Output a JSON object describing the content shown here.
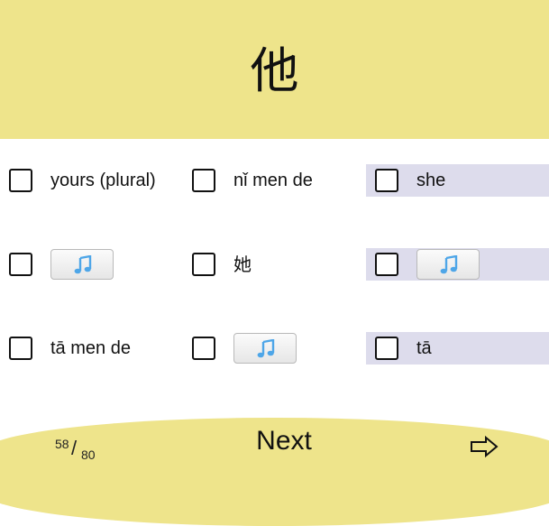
{
  "prompt": {
    "character": "他"
  },
  "options": [
    {
      "kind": "text",
      "text": "yours (plural)",
      "selected": false
    },
    {
      "kind": "text",
      "text": "nǐ men de",
      "selected": false
    },
    {
      "kind": "text",
      "text": "she",
      "selected": true
    },
    {
      "kind": "audio",
      "icon": "music-note-icon",
      "selected": false
    },
    {
      "kind": "text",
      "text": "她",
      "selected": false
    },
    {
      "kind": "audio",
      "icon": "music-note-icon",
      "selected": true
    },
    {
      "kind": "text",
      "text": "tā men de",
      "selected": false
    },
    {
      "kind": "audio",
      "icon": "music-note-icon",
      "selected": false
    },
    {
      "kind": "text",
      "text": "tā",
      "selected": true
    }
  ],
  "footer": {
    "progress_current": "58",
    "progress_total": "80",
    "next_label": "Next",
    "arrow_icon": "arrow-right-icon"
  },
  "colors": {
    "header_bg": "#eee48b",
    "selected_bg": "#dddcec",
    "note_icon": "#4ea6e8"
  }
}
